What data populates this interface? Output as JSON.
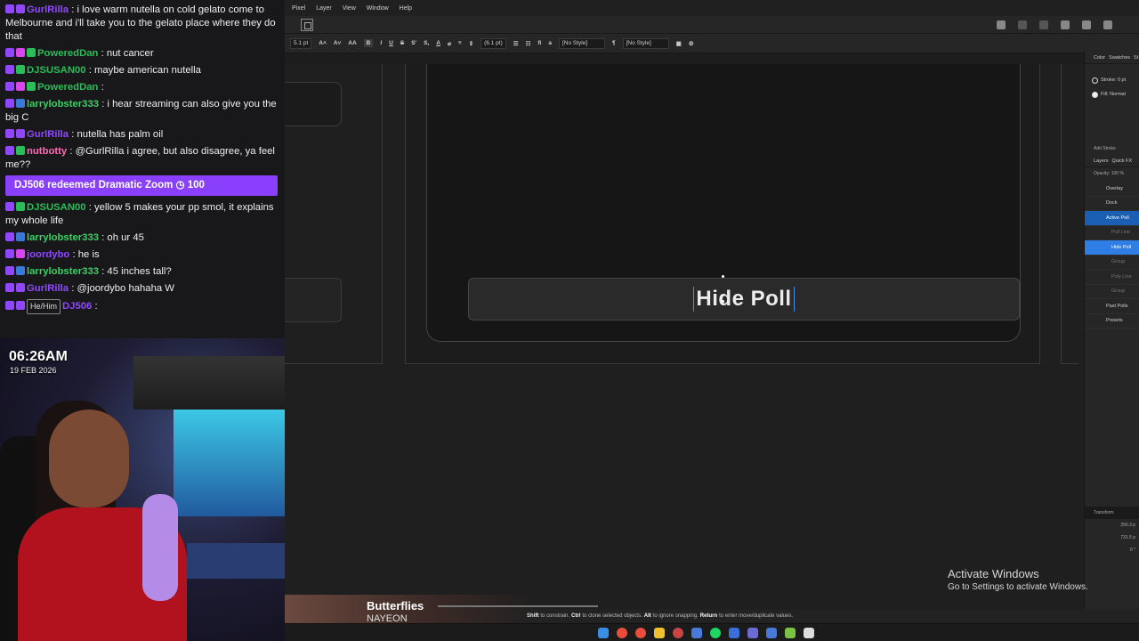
{
  "chat": {
    "messages": [
      {
        "user": "GurlRilla",
        "color": "#9147ff",
        "badges": [
          "purple",
          "purple"
        ],
        "text": ": i love warm nutella on cold gelato come to Melbourne and i'll take you to the gelato place where they do that"
      },
      {
        "user": "PoweredDan",
        "color": "#2bbd57",
        "badges": [
          "purple",
          "pink",
          "green"
        ],
        "text": ": nut cancer"
      },
      {
        "user": "DJSUSAN00",
        "color": "#2bbd57",
        "badges": [
          "purple",
          "green"
        ],
        "text": ": maybe american nutella"
      },
      {
        "user": "PoweredDan",
        "color": "#2bbd57",
        "badges": [
          "purple",
          "pink",
          "green"
        ],
        "text": ":"
      },
      {
        "user": "larrylobster333",
        "color": "#3ad164",
        "badges": [
          "purple",
          "blue"
        ],
        "text": ": i hear streaming can also give you the big C"
      },
      {
        "user": "GurlRilla",
        "color": "#9147ff",
        "badges": [
          "purple",
          "purple"
        ],
        "text": ": nutella has palm oil"
      },
      {
        "user": "nutbotty",
        "color": "#ff69b4",
        "badges": [
          "purple",
          "green"
        ],
        "text": ": @GurlRilla i agree, but also disagree, ya feel me??"
      }
    ],
    "redeem": "DJ506 redeemed Dramatic Zoom ◷ 100",
    "messages2": [
      {
        "user": "DJSUSAN00",
        "color": "#2bbd57",
        "badges": [
          "purple",
          "green"
        ],
        "text": ": yellow 5 makes your pp smol, it explains my whole life"
      },
      {
        "user": "larrylobster333",
        "color": "#3ad164",
        "badges": [
          "purple",
          "blue"
        ],
        "text": ": oh ur 45"
      },
      {
        "user": "joordybo",
        "color": "#9147ff",
        "badges": [
          "purple",
          "pink"
        ],
        "text": ": he is"
      },
      {
        "user": "larrylobster333",
        "color": "#3ad164",
        "badges": [
          "purple",
          "blue"
        ],
        "text": ": 45 inches tall?"
      },
      {
        "user": "GurlRilla",
        "color": "#9147ff",
        "badges": [
          "purple",
          "purple"
        ],
        "text": ": @joordybo hahaha W"
      },
      {
        "user": "DJ506",
        "color": "#9147ff",
        "badges": [
          "purple",
          "purple"
        ],
        "pronoun": "He/Him",
        "text": ":"
      }
    ]
  },
  "webcam": {
    "time": "06:26AM",
    "date": "19 FEB 2026"
  },
  "app": {
    "menu": [
      "Pixel",
      "Layer",
      "View",
      "Window",
      "Help"
    ],
    "ctx": {
      "font_size": "5.1 pt",
      "leading": "(6.1 pt)",
      "para_style": "[No Style]",
      "char_style": "[No Style]"
    },
    "canvas": {
      "button_text": "Hide Poll"
    },
    "panel": {
      "tabs": [
        "Color",
        "Swatches",
        "St"
      ],
      "stroke": "Stroke: 0 pt",
      "fill": "Fill: Normal",
      "add_stroke": "Add Stroke",
      "layer_tabs": [
        "Layers",
        "Quick FX"
      ],
      "opacity": "Opacity: 100 %",
      "layers": [
        {
          "name": "Overlay",
          "state": "normal",
          "child": false
        },
        {
          "name": "Dock",
          "state": "normal",
          "child": false
        },
        {
          "name": "Active Poll",
          "state": "active",
          "child": false
        },
        {
          "name": "Poll Line",
          "state": "dim",
          "child": true
        },
        {
          "name": "Hide Poll",
          "state": "sel",
          "child": true
        },
        {
          "name": "Group",
          "state": "dim",
          "child": true
        },
        {
          "name": "Poly Line",
          "state": "dim",
          "child": true
        },
        {
          "name": "Group",
          "state": "dim",
          "child": true
        },
        {
          "name": "Past Polls",
          "state": "normal",
          "child": false
        },
        {
          "name": "Presets",
          "state": "normal",
          "child": false
        }
      ],
      "transform_tab": "Transform",
      "transform_values": [
        "256.3 p",
        "731.5 p",
        "0 °"
      ]
    },
    "status": {
      "shift": "Shift",
      "shift_text": "to constrain.",
      "ctrl": "Ctrl",
      "ctrl_text": "to clone selected objects.",
      "alt": "Alt",
      "alt_text": "to ignore snapping.",
      "return": "Return",
      "return_text": "to enter move/duplicate values."
    },
    "activate": {
      "title": "Activate Windows",
      "subtitle": "Go to Settings to activate Windows."
    }
  },
  "now_playing": {
    "title": "Butterflies",
    "artist": "NAYEON"
  },
  "colors": {
    "accent_purple": "#8a3ffc",
    "selection_blue": "#2f7ee6",
    "panel_bg": "#262626"
  }
}
